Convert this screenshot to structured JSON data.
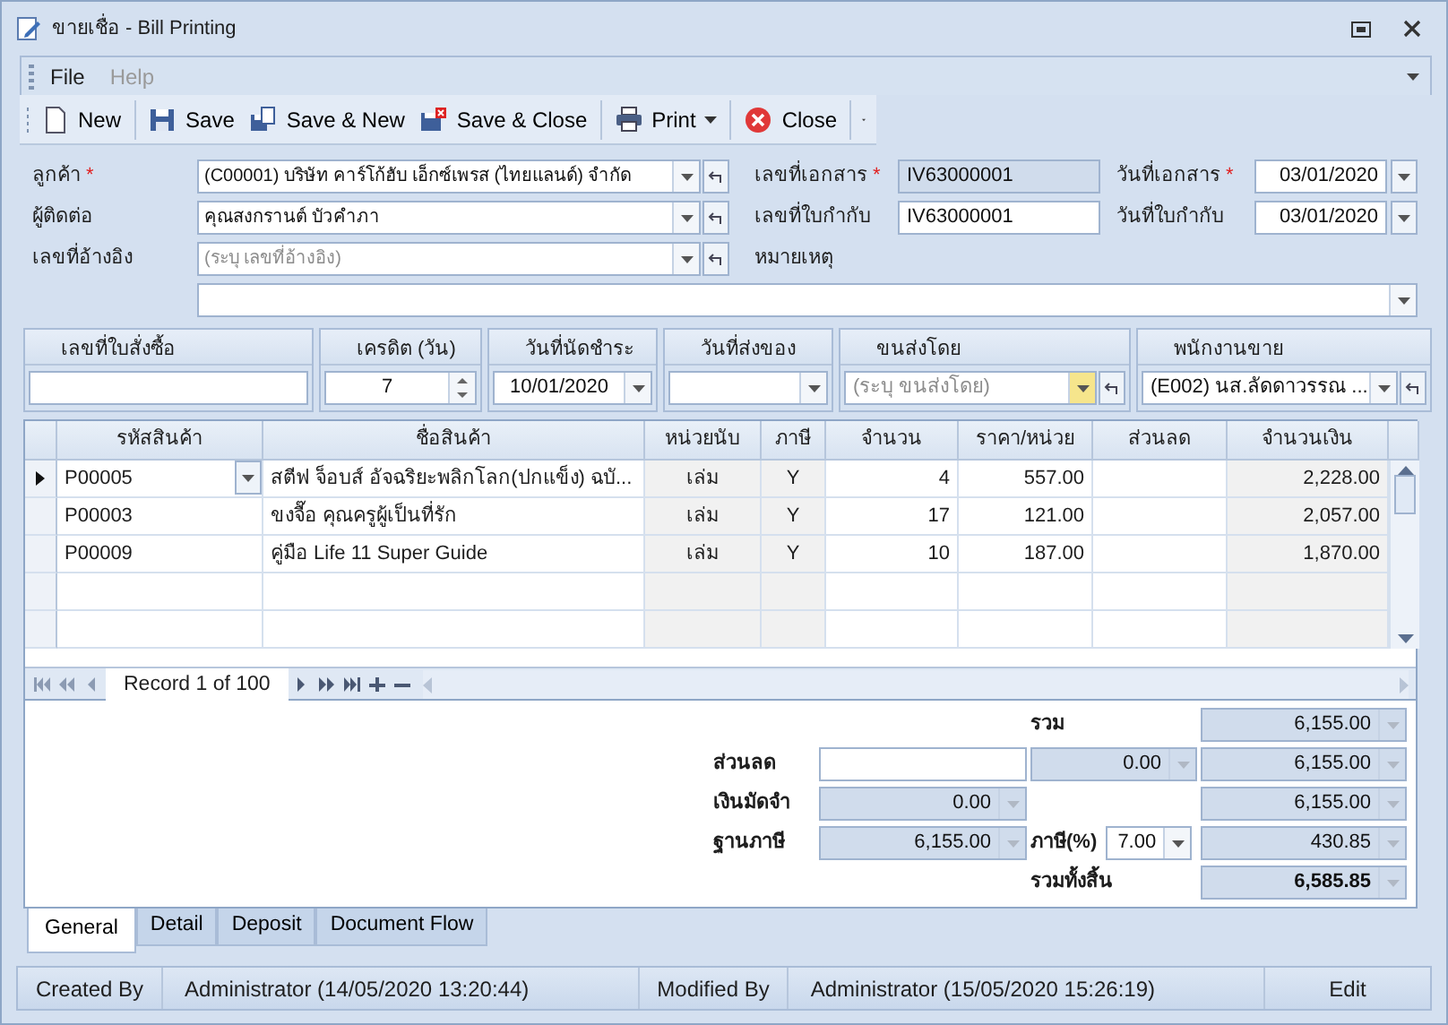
{
  "window": {
    "title": "ขายเชื่อ - Bill Printing"
  },
  "menu": [
    {
      "label": "File",
      "disabled": false
    },
    {
      "label": "Help",
      "disabled": true
    }
  ],
  "toolbar": [
    [
      {
        "label": "New",
        "dropdown": false
      }
    ],
    [
      {
        "label": "Save",
        "dropdown": false
      },
      {
        "label": "Save & New",
        "dropdown": false
      },
      {
        "label": "Save & Close",
        "dropdown": false
      }
    ],
    [
      {
        "label": "Print",
        "dropdown": true
      }
    ],
    [
      {
        "label": "Close",
        "dropdown": false
      }
    ]
  ],
  "header": [
    [
      {
        "label": "ลูกค้า",
        "mark": "*",
        "kind": "combo",
        "value": "(C00001) บริษัท คาร์โก้ฮับ เอ็กซ์เพรส (ไทยแลนด์) จำกัด",
        "readonly": false
      },
      {
        "label": "เลขที่เอกสาร",
        "mark": "*",
        "kind": "text",
        "value": "IV63000001",
        "readonly": true
      },
      {
        "label": "วันที่เอกสาร",
        "mark": "*",
        "kind": "date",
        "value": "03/01/2020",
        "readonly": false
      }
    ],
    [
      {
        "label": "ผู้ติดต่อ",
        "kind": "combo",
        "value": "คุณสงกรานต์ บัวคำภา",
        "readonly": false
      },
      {
        "label": "เลขที่ใบกำกับ",
        "kind": "text",
        "value": "IV63000001",
        "readonly": false
      },
      {
        "label": "วันที่ใบกำกับ",
        "kind": "date",
        "value": "03/01/2020",
        "readonly": false
      }
    ],
    [
      {
        "label": "เลขที่อ้างอิง",
        "kind": "combo",
        "placeholder": "(ระบุ เลขที่อ้างอิง)",
        "readonly": false
      }
    ],
    [
      {
        "label": "หมายเหตุ",
        "kind": "memo",
        "readonly": false
      }
    ]
  ],
  "groups": [
    {
      "label": "เลขที่ใบสั่งซื้อ",
      "kind": "text"
    },
    {
      "label": "เครดิต (วัน)",
      "kind": "spin",
      "value": "7"
    },
    {
      "label": "วันที่นัดชำระ",
      "kind": "date",
      "value": "10/01/2020",
      "hot": false
    },
    {
      "label": "วันที่ส่งของ",
      "kind": "date",
      "hot": false
    },
    {
      "label": "ขนส่งโดย",
      "kind": "combo",
      "placeholder": "(ระบุ ขนส่งโดย)",
      "hot": true
    },
    {
      "label": "พนักงานขาย",
      "kind": "combo",
      "value": "(E002) นส.ลัดดาวรรณ ...",
      "hot": false
    }
  ],
  "table": {
    "columns": [
      {
        "label": "รหัสสินค้า",
        "kind": "text",
        "readonly": false
      },
      {
        "label": "ชื่อสินค้า",
        "kind": "text",
        "readonly": false
      },
      {
        "label": "หน่วยนับ",
        "kind": "center",
        "readonly": true
      },
      {
        "label": "ภาษี",
        "kind": "center",
        "readonly": true
      },
      {
        "label": "จำนวน",
        "kind": "number",
        "readonly": false
      },
      {
        "label": "ราคา/หน่วย",
        "kind": "number",
        "readonly": false
      },
      {
        "label": "ส่วนลด",
        "kind": "number",
        "readonly": false
      },
      {
        "label": "จำนวนเงิน",
        "kind": "number",
        "readonly": true
      }
    ],
    "rows": [
      {
        "selected": true,
        "cells": [
          "P00005",
          "สตีฟ จ็อบส์ อัจฉริยะพลิกโลก(ปกแข็ง) ฉบั...",
          "เล่ม",
          "Y",
          "4",
          "557.00",
          null,
          "2,228.00"
        ]
      },
      {
        "selected": false,
        "cells": [
          "P00003",
          "ขงจื๊อ คุณครูผู้เป็นที่รัก",
          "เล่ม",
          "Y",
          "17",
          "121.00",
          null,
          "2,057.00"
        ]
      },
      {
        "selected": false,
        "cells": [
          "P00009",
          "คู่มือ Life 11 Super Guide",
          "เล่ม",
          "Y",
          "10",
          "187.00",
          null,
          "1,870.00"
        ]
      }
    ],
    "navigator": "Record 1 of 100"
  },
  "summary": [
    [
      {
        "kind": "blank"
      },
      {
        "kind": "blank"
      },
      {
        "kind": "label",
        "text": "รวม"
      },
      {
        "kind": "field",
        "value": "6,155.00",
        "readonly": true,
        "bold": false
      }
    ],
    [
      {
        "kind": "label",
        "text": "ส่วนลด"
      },
      {
        "kind": "input"
      },
      {
        "kind": "field",
        "value": "0.00",
        "readonly": true,
        "bold": false
      },
      {
        "kind": "field",
        "value": "6,155.00",
        "readonly": true,
        "bold": false
      }
    ],
    [
      {
        "kind": "label",
        "text": "เงินมัดจำ"
      },
      {
        "kind": "field",
        "value": "0.00",
        "readonly": true,
        "bold": false
      },
      {
        "kind": "blank"
      },
      {
        "kind": "field",
        "value": "6,155.00",
        "readonly": true,
        "bold": false
      }
    ],
    [
      {
        "kind": "label",
        "text": "ฐานภาษี"
      },
      {
        "kind": "field",
        "value": "6,155.00",
        "readonly": true,
        "bold": false
      },
      {
        "kind": "labelled",
        "text": "ภาษี(%)",
        "value": "7.00",
        "readonly": false
      },
      {
        "kind": "field",
        "value": "430.85",
        "readonly": true,
        "bold": false
      }
    ],
    [
      {
        "kind": "blank"
      },
      {
        "kind": "blank"
      },
      {
        "kind": "label",
        "text": "รวมทั้งสิ้น"
      },
      {
        "kind": "field",
        "value": "6,585.85",
        "readonly": true,
        "bold": true
      }
    ]
  ],
  "tabs": [
    {
      "label": "General",
      "selected": true
    },
    {
      "label": "Detail",
      "selected": false
    },
    {
      "label": "Deposit",
      "selected": false
    },
    {
      "label": "Document Flow",
      "selected": false
    }
  ],
  "status_bar": [
    {
      "kind": "caption",
      "text": "Created By"
    },
    {
      "kind": "value",
      "text": "Administrator (14/05/2020 13:20:44)"
    },
    {
      "kind": "caption",
      "text": "Modified By"
    },
    {
      "kind": "value",
      "text": "Administrator (15/05/2020 15:26:19)"
    },
    {
      "kind": "mode",
      "text": "Edit"
    }
  ]
}
